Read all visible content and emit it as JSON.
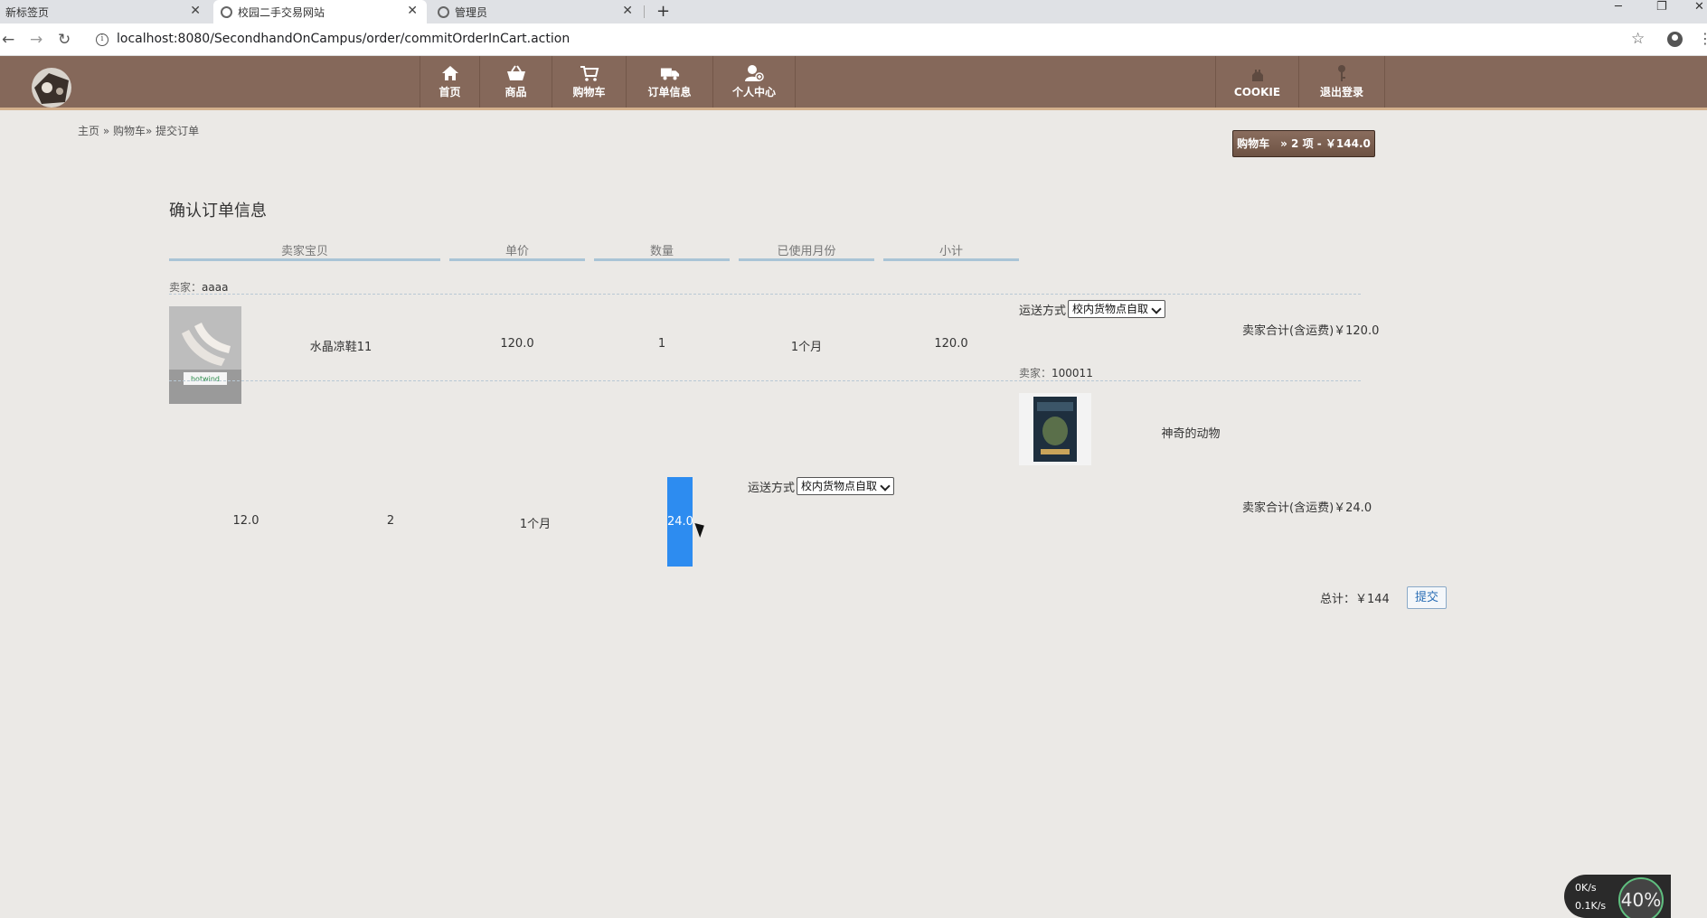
{
  "browser": {
    "tabs": [
      {
        "title": "新标签页"
      },
      {
        "title": "校园二手交易网站"
      },
      {
        "title": "管理员"
      }
    ],
    "url": "localhost:8080/SecondhandOnCampus/order/commitOrderInCart.action"
  },
  "nav": {
    "items": [
      "首页",
      "商品",
      "购物车",
      "订单信息",
      "个人中心"
    ],
    "right_items": [
      "COOKIE",
      "退出登录"
    ]
  },
  "breadcrumb": "主页 » 购物车» 提交订单",
  "cart_badge": "购物车　» 2 项 - ￥144.0",
  "section_title": "确认订单信息",
  "columns": [
    "卖家宝贝",
    "单价",
    "数量",
    "已使用月份",
    "小计"
  ],
  "seller_prefix": "卖家：",
  "sellers": [
    {
      "name": "aaaa",
      "item": {
        "name": "水晶凉鞋11",
        "price": "120.0",
        "qty": "1",
        "months": "1个月",
        "subtotal": "120.0"
      },
      "shipping_label": "运送方式",
      "shipping_value": "校内货物点自取",
      "seller_total": "卖家合计(含运费)￥120.0"
    },
    {
      "name": "100011",
      "item": {
        "name": "神奇的动物",
        "price": "12.0",
        "qty": "2",
        "months": "1个月",
        "subtotal": "24.0"
      },
      "shipping_label": "运送方式",
      "shipping_value": "校内货物点自取",
      "seller_total": "卖家合计(含运费)￥24.0"
    }
  ],
  "total": "总计：￥144",
  "submit_label": "提交",
  "net_widget": {
    "up": "0K/s",
    "down": "0.1K/s",
    "percent": "40%"
  }
}
